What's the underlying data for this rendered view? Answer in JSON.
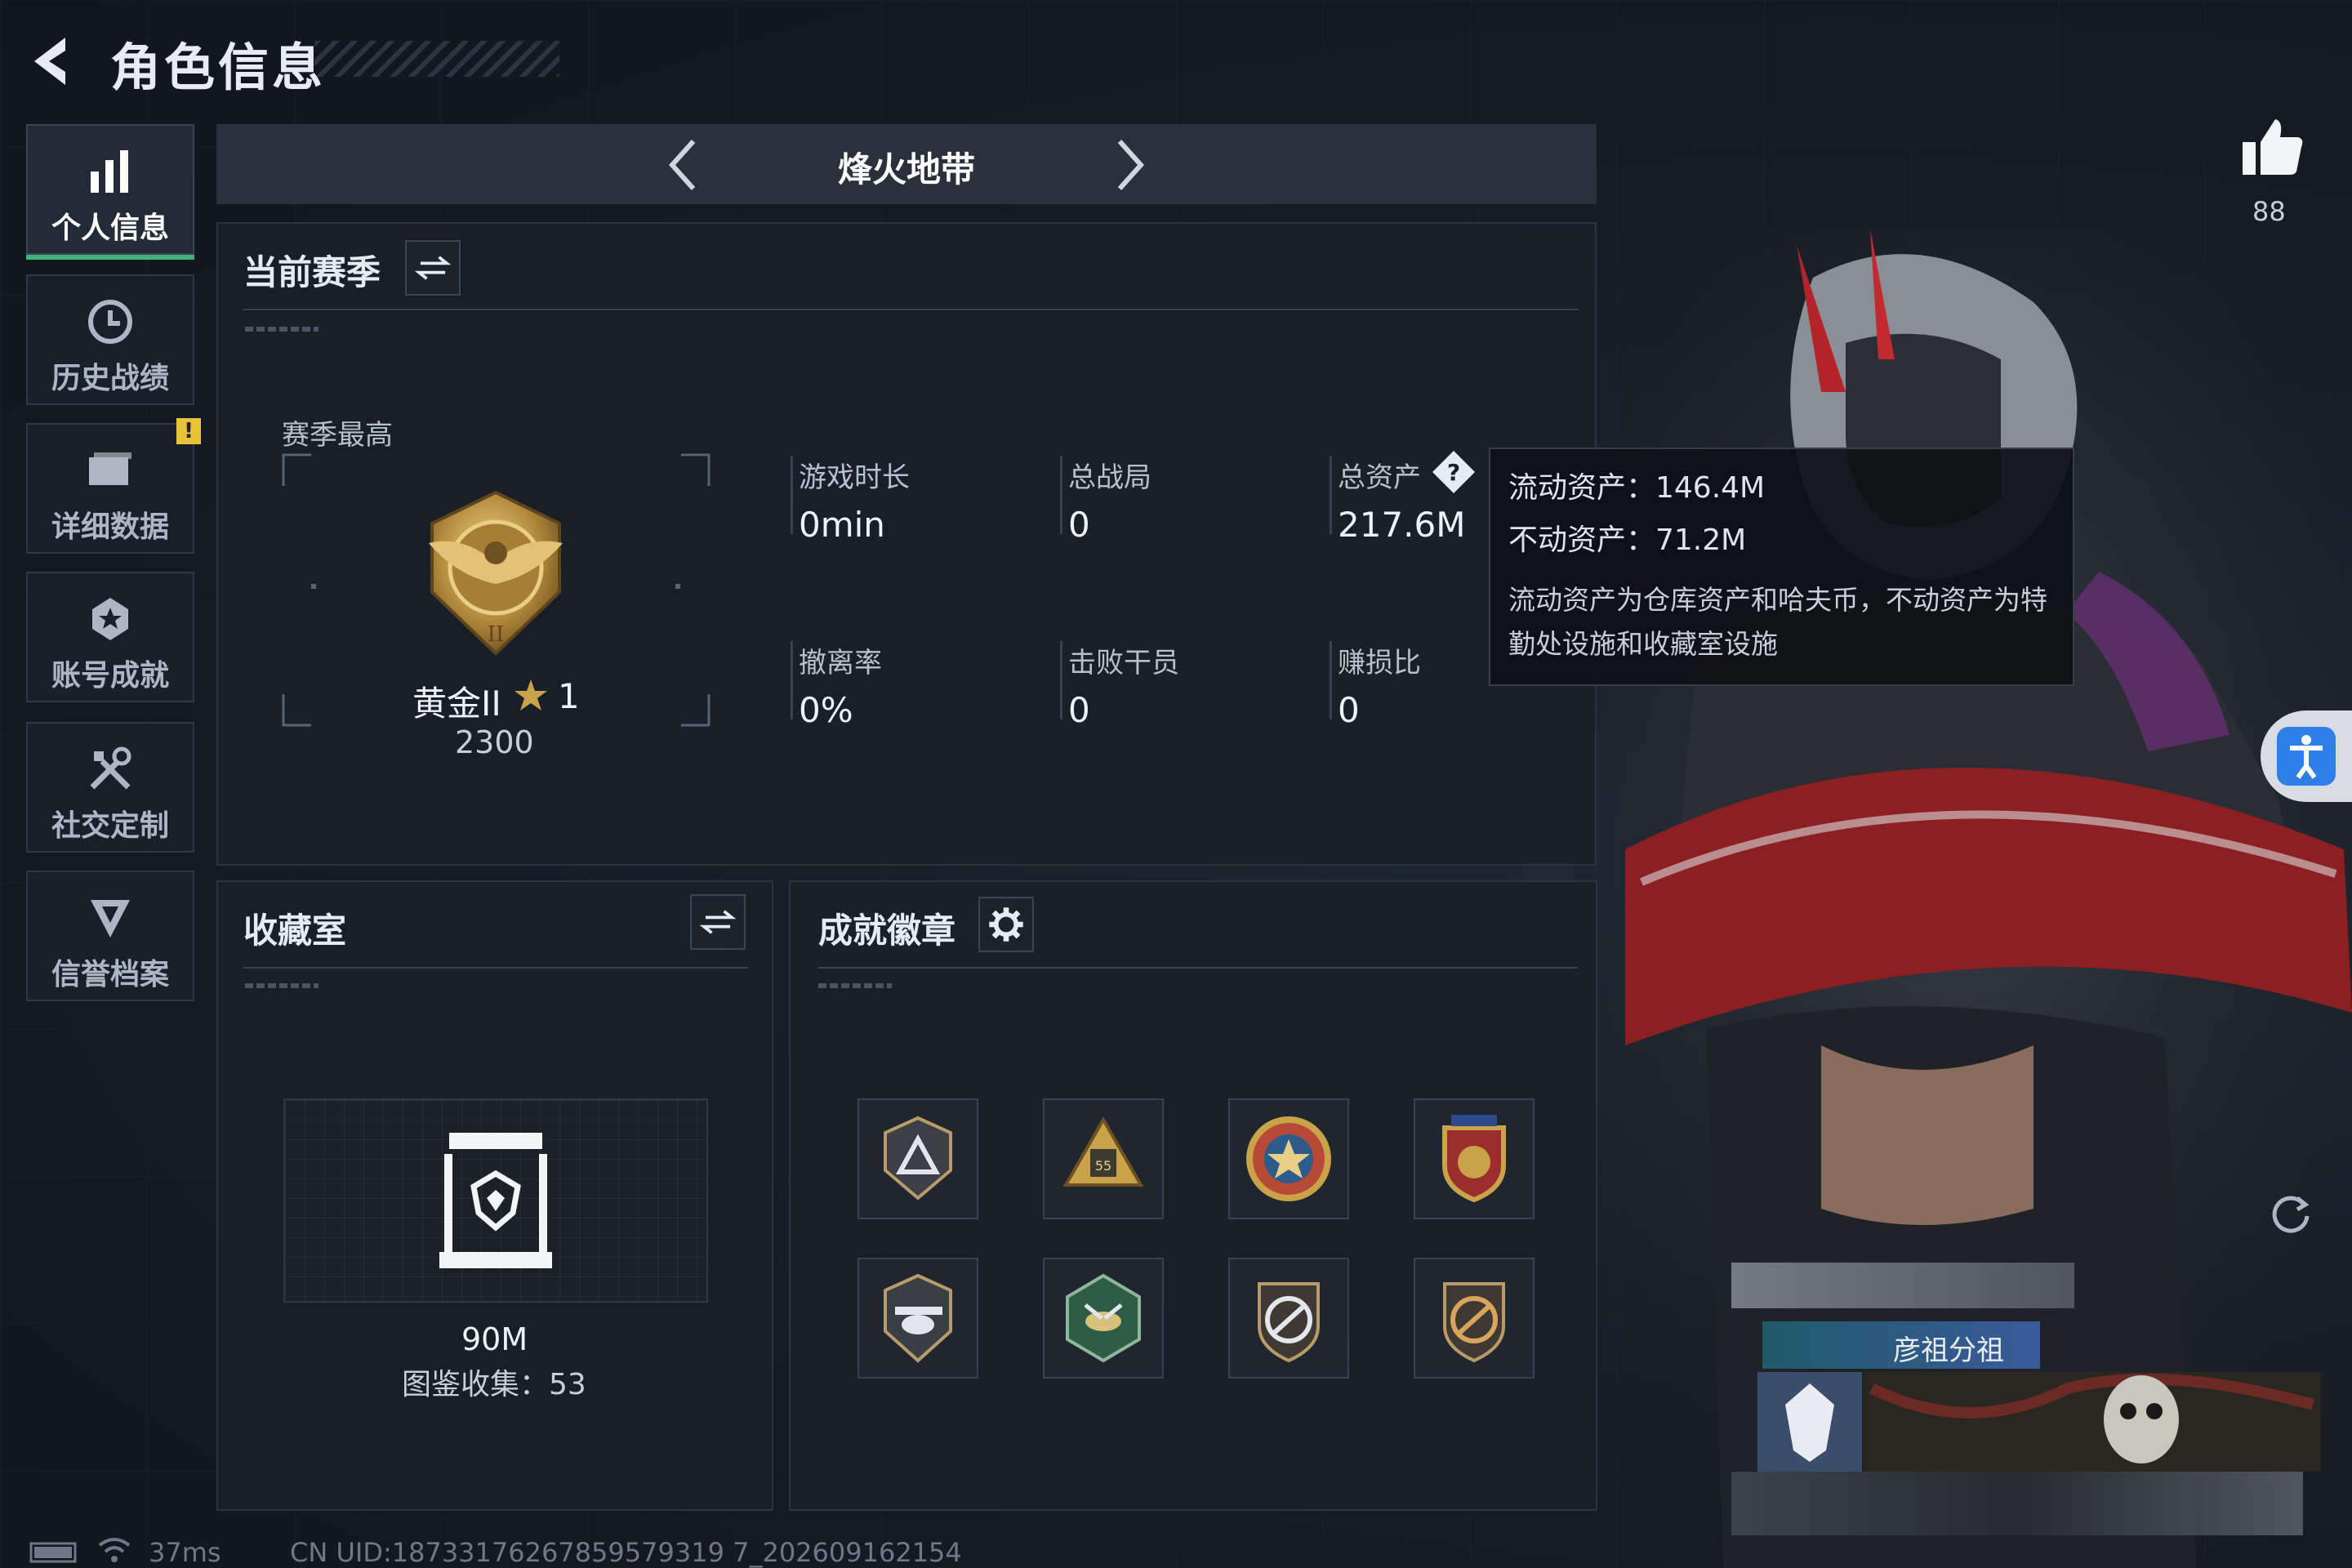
{
  "header": {
    "title": "角色信息"
  },
  "sidebar": {
    "items": [
      {
        "label": "个人信息",
        "icon": "bar-chart-icon",
        "active": true
      },
      {
        "label": "历史战绩",
        "icon": "history-icon",
        "active": false
      },
      {
        "label": "详细数据",
        "icon": "folder-icon",
        "active": false,
        "warning": "!"
      },
      {
        "label": "账号成就",
        "icon": "achievement-icon",
        "active": false
      },
      {
        "label": "社交定制",
        "icon": "tools-icon",
        "active": false
      },
      {
        "label": "信誉档案",
        "icon": "credit-icon",
        "active": false
      }
    ]
  },
  "mode": {
    "name": "烽火地带"
  },
  "season": {
    "title": "当前赛季",
    "best_label": "赛季最高",
    "rank_name": "黄金II",
    "rank_star": "1",
    "rank_score": "2300",
    "stats": [
      {
        "label": "游戏时长",
        "value": "0min"
      },
      {
        "label": "总战局",
        "value": "0"
      },
      {
        "label": "总资产",
        "value": "217.6M"
      },
      {
        "label": "撤离率",
        "value": "0%"
      },
      {
        "label": "击败干员",
        "value": "0"
      },
      {
        "label": "赚损比",
        "value": "0"
      }
    ]
  },
  "tooltip": {
    "liquid": "流动资产：146.4M",
    "fixed": "不动资产：71.2M",
    "desc": "流动资产为仓库资产和哈夫币，不动资产为特勤处设施和收藏室设施"
  },
  "collection": {
    "title": "收藏室",
    "value": "90M",
    "catalog": "图鉴收集：53"
  },
  "badges": {
    "title": "成就徽章",
    "count": 8
  },
  "likes": {
    "count": "88"
  },
  "team": {
    "name": "彦祖分祖"
  },
  "status_bar": {
    "ping": "37ms",
    "uid": "CN UID:18733176267859579319 7_202609162154"
  },
  "colors": {
    "accent_green": "#3fb37a",
    "warning": "#e8c33a",
    "access_blue": "#2f7fe8",
    "gold": "#c9a24a"
  }
}
